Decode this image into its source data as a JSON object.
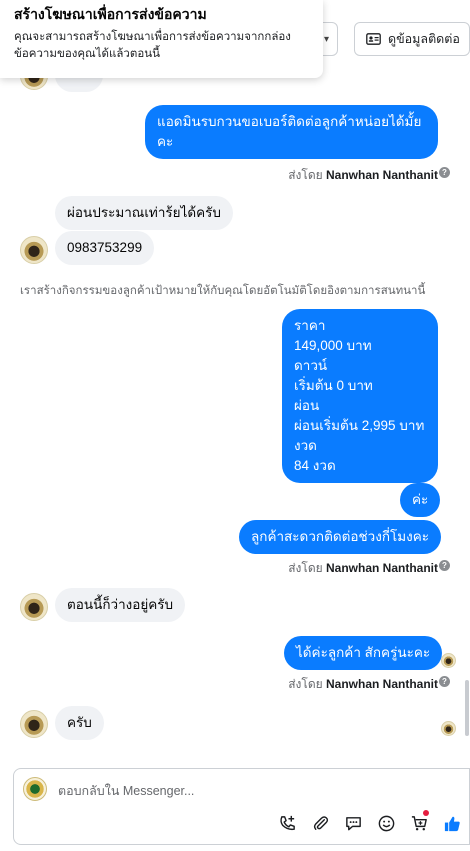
{
  "tooltip": {
    "title": "สร้างโฆษณาเพื่อการส่งข้อความ",
    "body_line1": "คุณจะสามารถสร้างโฆษณาเพื่อการส่งข้อความจากกล่อง",
    "body_line2": "ข้อความของคุณได้แล้วตอนนี้"
  },
  "header": {
    "contact_button_label": "ดูข้อมูลติดต่อ"
  },
  "messages": {
    "out1_line1": "แอดมินรบกวนขอเบอร์ติดต่อลูกค้าหน่อยได้มั้ย",
    "out1_line2": "คะ",
    "in1": "ผ่อนประมาณเท่าร้ยได้ครับ",
    "in2": "0983753299",
    "system_note": "เราสร้างกิจกรรมของลูกค้าเป้าหมายให้กับคุณโดยอัตโนมัติโดยอิงตามการสนทนานี้",
    "price_lines": [
      "ราคา",
      "149,000 บาท",
      "ดาวน์",
      "เริ่มต้น 0 บาท",
      "ผ่อน",
      "ผ่อนเริ่มต้น 2,995 บาท",
      "งวด",
      "84 งวด"
    ],
    "out_ka": "ค่ะ",
    "out_time": "ลูกค้าสะดวกติดต่อช่วงกี่โมงคะ",
    "in3": "ตอนนี้ก็ว่างอยู่ครับ",
    "out_wait": "ได้ค่ะลูกค้า สักครู่นะคะ",
    "in4": "ครับ"
  },
  "sent_by": {
    "prefix": "ส่งโดย",
    "name": "Nanwhan Nanthanit"
  },
  "composer": {
    "placeholder": "ตอบกลับใน Messenger..."
  },
  "icons": {
    "help": "help-icon",
    "call": "phone-plus-icon",
    "attach": "paperclip-icon",
    "saved_reply": "chat-bubble-icon",
    "emoji": "smiley-icon",
    "cart": "cart-plus-icon",
    "like": "thumbs-up-icon"
  },
  "colors": {
    "outgoing_bubble": "#0a7cff",
    "incoming_bubble": "#f0f2f5",
    "like_icon": "#0a7cff"
  }
}
